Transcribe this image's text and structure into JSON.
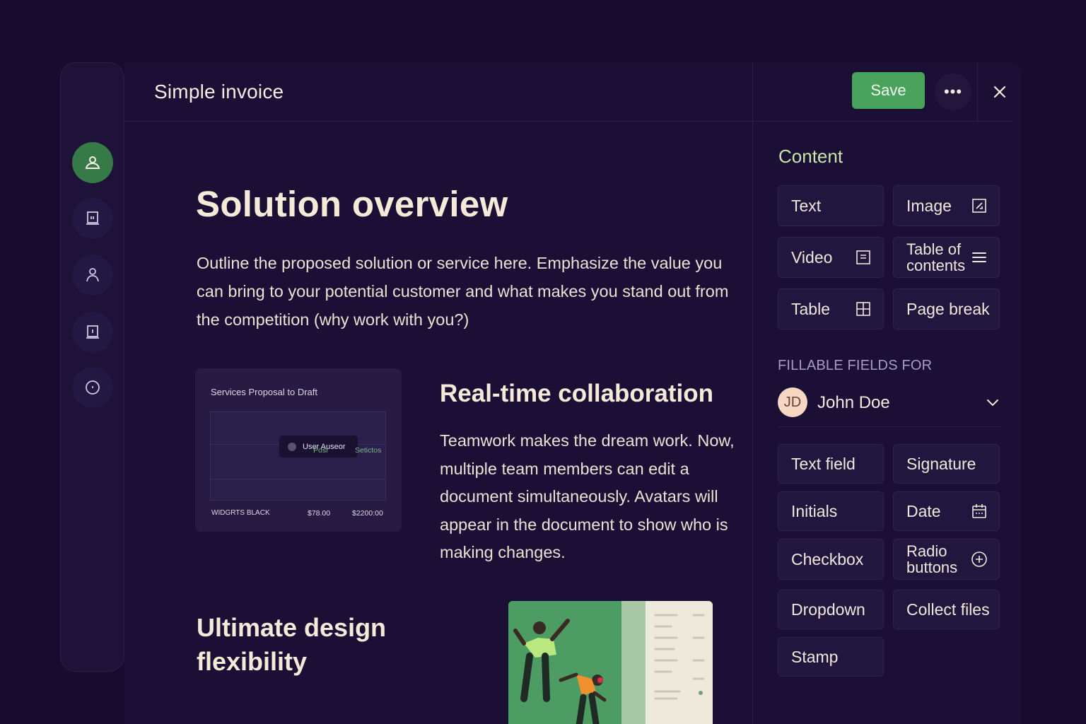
{
  "header": {
    "doc_title": "Simple invoice",
    "save_label": "Save",
    "more_label": "•••",
    "close_label": "×"
  },
  "sidebar": {
    "items": [
      {
        "icon": "user-icon",
        "active": true
      },
      {
        "icon": "document-icon",
        "active": false
      },
      {
        "icon": "person-icon",
        "active": false
      },
      {
        "icon": "template-icon",
        "active": false
      },
      {
        "icon": "help-icon",
        "active": false
      }
    ]
  },
  "document": {
    "heading": "Solution overview",
    "intro": "Outline the proposed solution or service here. Emphasize the value you can bring to your potential customer and what makes you stand out from the competition (why work with you?)",
    "card": {
      "title": "Services Proposal to Draft",
      "chip_label": "User Auseor",
      "col1": "Posr",
      "col2": "Setictos",
      "row_name": "WIDGRTS BLACK",
      "row_price": "$78.00",
      "row_total": "$2200:00"
    },
    "collab_heading": "Real-time collaboration",
    "collab_text": "Teamwork makes the dream work. Now, multiple team members can edit a document simultaneously. Avatars will appear in the document to show who is making changes.",
    "design_heading": "Ultimate design flexibility"
  },
  "panel": {
    "content_heading": "Content",
    "content_items": [
      {
        "label": "Text",
        "icon": ""
      },
      {
        "label": "Image",
        "icon": "image-icon"
      },
      {
        "label": "Video",
        "icon": "video-icon"
      },
      {
        "label": "Table of contents",
        "icon": "list-icon"
      },
      {
        "label": "Table",
        "icon": "table-icon"
      },
      {
        "label": "Page break",
        "icon": ""
      }
    ],
    "fillable_heading": "FILLABLE FIELDS FOR",
    "user": {
      "initials": "JD",
      "name": "John Doe"
    },
    "field_items": [
      {
        "label": "Text field"
      },
      {
        "label": "Signature"
      },
      {
        "label": "Initials"
      },
      {
        "label": "Date",
        "icon": "calendar-icon"
      },
      {
        "label": "Checkbox"
      },
      {
        "label": "Radio buttons",
        "icon": "plus-circle-icon"
      },
      {
        "label": "Dropdown"
      },
      {
        "label": "Collect files"
      },
      {
        "label": "Stamp"
      }
    ]
  },
  "colors": {
    "background": "#170c30",
    "accent_green": "#4aa35c",
    "content_heading": "#c8e6a8"
  }
}
